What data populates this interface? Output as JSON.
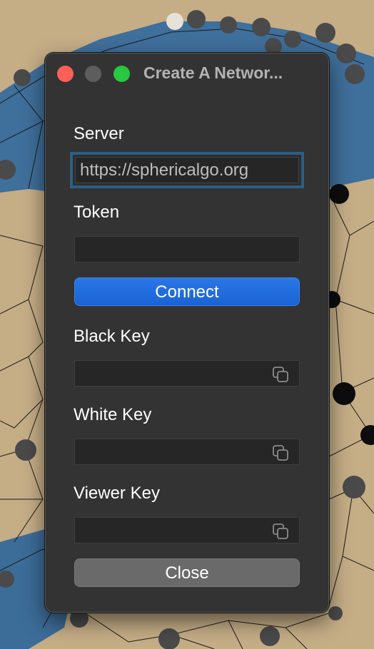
{
  "window": {
    "title": "Create A Networ..."
  },
  "form": {
    "server_label": "Server",
    "server_value": "https://sphericalgo.org",
    "token_label": "Token",
    "token_value": "",
    "connect_label": "Connect",
    "black_key_label": "Black Key",
    "white_key_label": "White Key",
    "viewer_key_label": "Viewer Key",
    "close_label": "Close"
  },
  "icons": {
    "copy": "copy-icon"
  },
  "colors": {
    "accent": "#1a63d6",
    "focus_ring": "#2b5f85",
    "close_light": "#fe5f57",
    "zoom_light": "#28c840"
  }
}
